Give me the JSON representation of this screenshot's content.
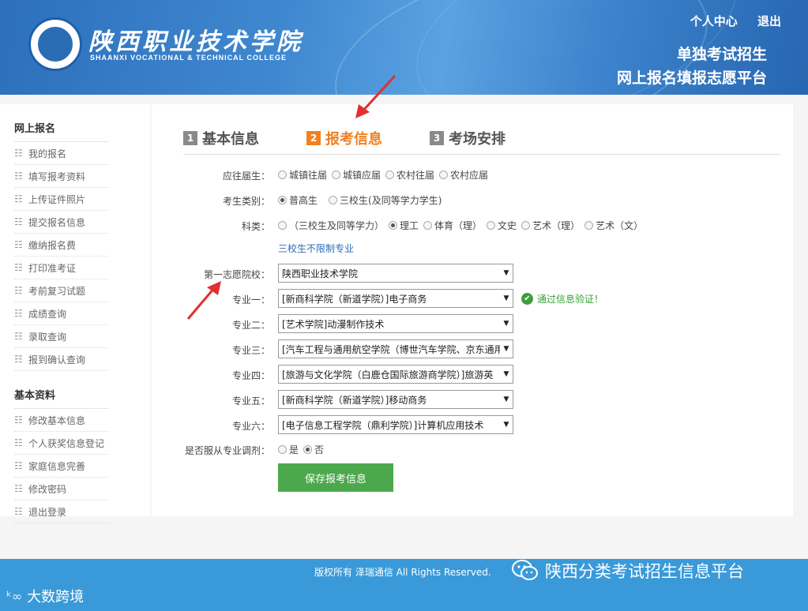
{
  "header": {
    "college_cn": "陕西职业技术学院",
    "college_en": "SHAANXI VOCATIONAL & TECHNICAL COLLEGE",
    "links": [
      "个人中心",
      "退出"
    ],
    "platform_line1": "单独考试招生",
    "platform_line2": "网上报名填报志愿平台"
  },
  "sidebar": {
    "sections": [
      {
        "title": "网上报名",
        "items": [
          "我的报名",
          "填写报考资料",
          "上传证件照片",
          "提交报名信息",
          "缴纳报名费",
          "打印准考证",
          "考前复习试题",
          "成绩查询",
          "录取查询",
          "报到确认查询"
        ]
      },
      {
        "title": "基本资料",
        "items": [
          "修改基本信息",
          "个人获奖信息登记",
          "家庭信息完善",
          "修改密码",
          "退出登录"
        ]
      }
    ]
  },
  "steps": [
    {
      "num": "1",
      "label": "基本信息",
      "active": false
    },
    {
      "num": "2",
      "label": "报考信息",
      "active": true
    },
    {
      "num": "3",
      "label": "考场安排",
      "active": false
    }
  ],
  "form": {
    "graduate": {
      "label": "应往届生：",
      "options": [
        "城镇往届",
        "城镇应届",
        "农村往届",
        "农村应届"
      ],
      "selected": -1
    },
    "category": {
      "label": "考生类别：",
      "options": [
        "普高生",
        "三校生(及同等学力学生)"
      ],
      "selected": 0
    },
    "subject": {
      "label": "科类：",
      "options": [
        "（三校生及同等学力）",
        "理工",
        "体育（理）",
        "文史",
        "艺术（理）",
        "艺术（文）"
      ],
      "selected": 1
    },
    "note": "三校生不限制专业",
    "first_choice": {
      "label": "第一志愿院校：",
      "value": "陕西职业技术学院"
    },
    "majors": [
      {
        "label": "专业一：",
        "value": "[新商科学院（新道学院）]电子商务"
      },
      {
        "label": "专业二：",
        "value": "[艺术学院]动漫制作技术"
      },
      {
        "label": "专业三：",
        "value": "[汽车工程与通用航空学院（博世汽车学院、京东通用"
      },
      {
        "label": "专业四：",
        "value": "[旅游与文化学院（白鹿仓国际旅游商学院）]旅游英"
      },
      {
        "label": "专业五：",
        "value": "[新商科学院（新道学院）]移动商务"
      },
      {
        "label": "专业六：",
        "value": "[电子信息工程学院（鼎利学院）]计算机应用技术"
      }
    ],
    "verify_text": "通过信息验证！",
    "adjust": {
      "label": "是否服从专业调剂：",
      "options": [
        "是",
        "否"
      ],
      "selected": 1
    },
    "save_label": "保存报考信息"
  },
  "footer": {
    "copyright": "版权所有 泽瑞通信 All Rights Reserved.",
    "wechat_title": "陕西分类考试招生信息平台",
    "watermark": "大数跨境"
  },
  "colors": {
    "accent": "#f08020",
    "header_blue": "#3f88d0",
    "footer_blue": "#3a9ad9",
    "button_green": "#4ca84c",
    "verify_green": "#3aa03a",
    "arrow_red": "#e03030"
  }
}
